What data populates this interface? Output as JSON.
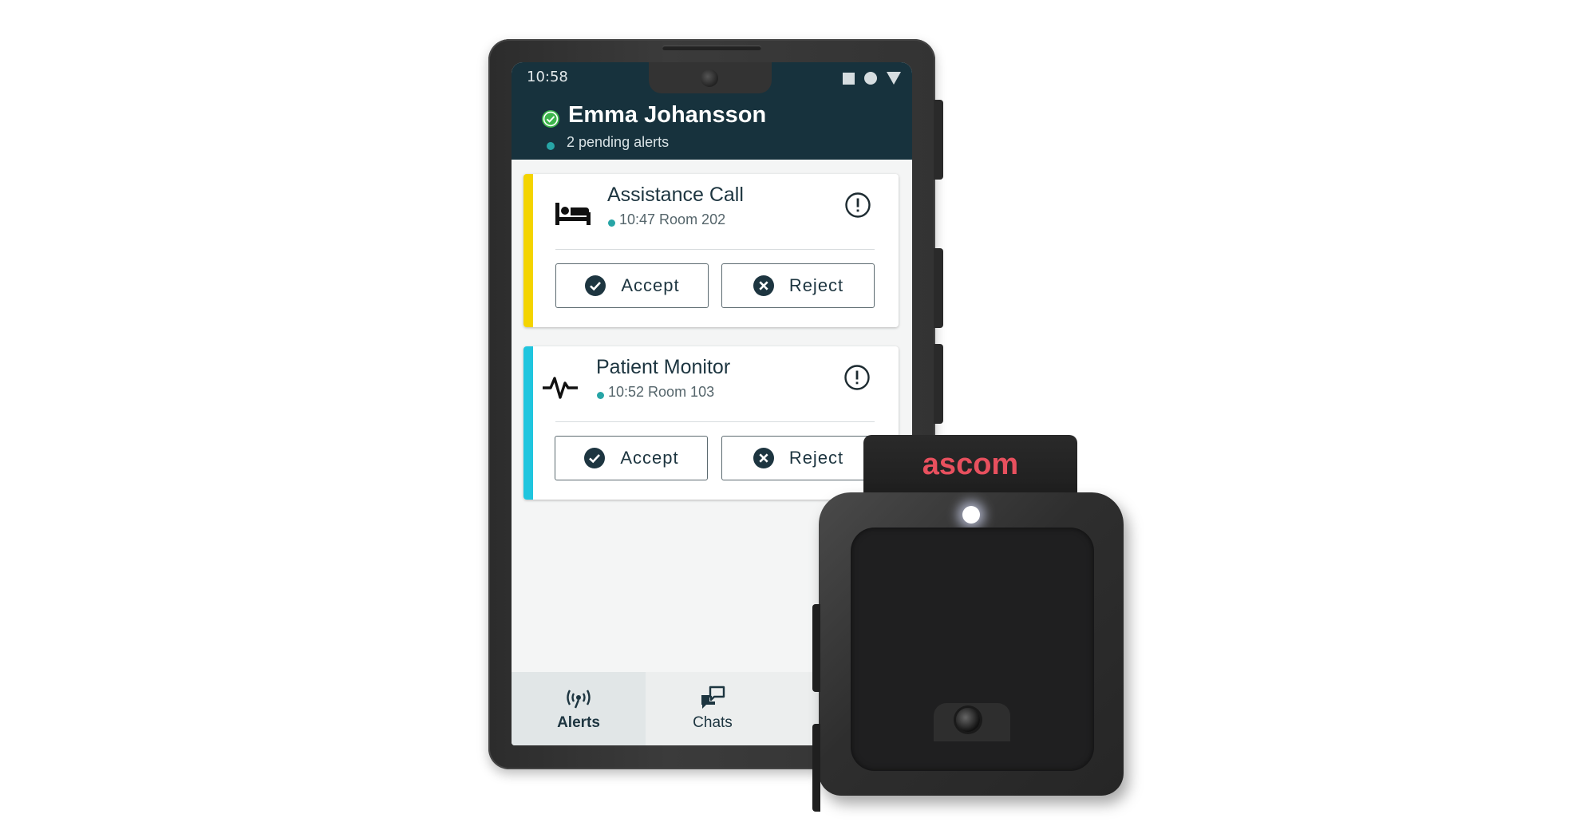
{
  "status_bar": {
    "time": "10:58"
  },
  "header": {
    "user_name": "Emma Johansson",
    "pending": "2 pending alerts"
  },
  "alerts": [
    {
      "title": "Assistance Call",
      "meta": "10:47 Room 202",
      "icon": "bed-icon",
      "stripe_color": "#f4d400",
      "accept_label": "Accept",
      "reject_label": "Reject"
    },
    {
      "title": "Patient Monitor",
      "meta": "10:52 Room 103",
      "icon": "heartbeat-icon",
      "stripe_color": "#1fc5de",
      "accept_label": "Accept",
      "reject_label": "Reject"
    }
  ],
  "nav": {
    "alerts_label": "Alerts",
    "chats_label": "Chats"
  },
  "device": {
    "brand": "ascom"
  },
  "colors": {
    "header_bg": "#17323d",
    "accent_teal": "#27a5a6",
    "status_ok": "#3cb54a",
    "brand_red": "#e8505e"
  }
}
